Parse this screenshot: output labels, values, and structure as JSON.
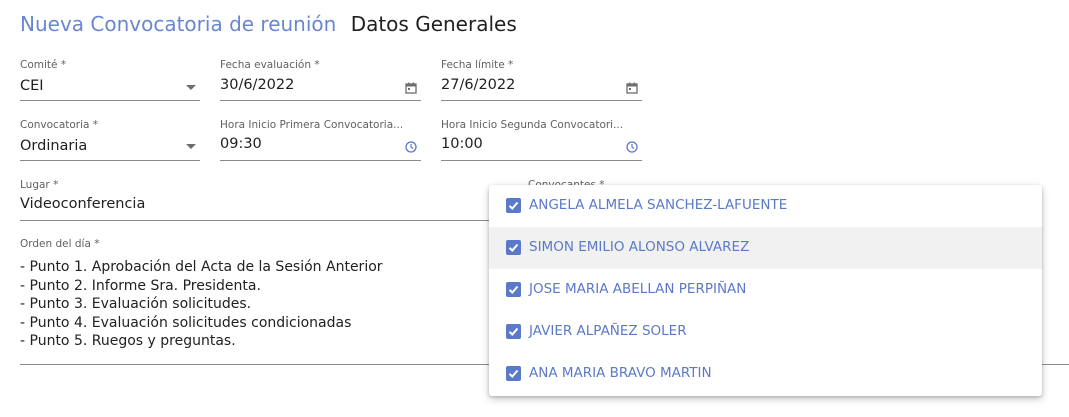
{
  "header": {
    "title": "Nueva Convocatoria de reunión",
    "subtitle": "Datos Generales"
  },
  "form": {
    "comite": {
      "label": "Comité *",
      "value": "CEI"
    },
    "fecha_evaluacion": {
      "label": "Fecha evaluación *",
      "value": "30/6/2022"
    },
    "fecha_limite": {
      "label": "Fecha límite *",
      "value": "27/6/2022"
    },
    "convocatoria": {
      "label": "Convocatoria *",
      "value": "Ordinaria"
    },
    "hora_inicio_primera": {
      "label": "Hora Inicio Primera Convocatoria...",
      "value": "09:30"
    },
    "hora_inicio_segunda": {
      "label": "Hora Inicio Segunda Convocatori...",
      "value": "10:00"
    },
    "lugar": {
      "label": "Lugar *",
      "value": "Videoconferencia"
    },
    "convocantes": {
      "label": "Convocantes *"
    },
    "orden_del_dia": {
      "label": "Orden del día *",
      "lines": [
        "- Punto 1. Aprobación del Acta de la Sesión Anterior",
        "- Punto 2. Informe Sra. Presidenta.",
        "- Punto 3. Evaluación solicitudes.",
        "- Punto 4. Evaluación solicitudes condicionadas",
        "- Punto 5. Ruegos y preguntas."
      ]
    }
  },
  "icons": {
    "calendar": "calendar-icon",
    "clock": "clock-icon",
    "dropdown": "chevron-down-icon",
    "checkbox": "check-icon"
  },
  "convocantes_options": [
    {
      "label": "ANGELA ALMELA SANCHEZ-LAFUENTE",
      "checked": true
    },
    {
      "label": "SIMON EMILIO ALONSO ALVAREZ",
      "checked": true
    },
    {
      "label": "JOSE MARIA ABELLAN PERPIÑAN",
      "checked": true
    },
    {
      "label": "JAVIER ALPAÑEZ SOLER",
      "checked": true
    },
    {
      "label": "ANA MARIA BRAVO MARTIN",
      "checked": true
    }
  ],
  "colors": {
    "primary": "#6b86d0",
    "checkbox": "#5b79c8",
    "text": "#212121",
    "label": "#616161"
  }
}
